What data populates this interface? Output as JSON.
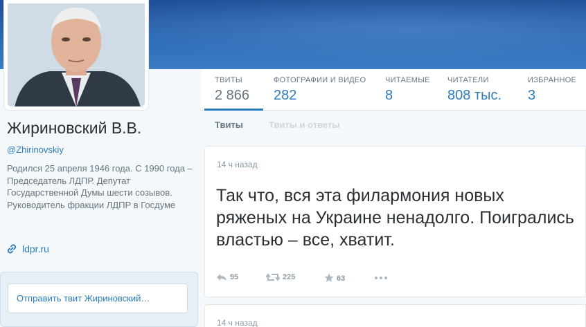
{
  "profile": {
    "name": "Жириновский В.В.",
    "handle": "@Zhirinovskiy",
    "bio": "Родился 25 апреля 1946 года. С 1990 года – Председатель ЛДПР. Депутат Государственной Думы шести созывов. Руководитель фракции ЛДПР в Госдуме",
    "link": "ldpr.ru",
    "link_icon": "link-icon",
    "send_placeholder": "Отправить твит Жириновский…"
  },
  "stats": [
    {
      "label": "ТВИТЫ",
      "value": "2 866"
    },
    {
      "label": "ФОТОГРАФИИ И ВИДЕО",
      "value": "282"
    },
    {
      "label": "ЧИТАЕМЫЕ",
      "value": "8"
    },
    {
      "label": "ЧИТАТЕЛИ",
      "value": "808 тыс."
    },
    {
      "label": "ИЗБРАННОЕ",
      "value": "3"
    }
  ],
  "tabs": {
    "tweets": "Твиты",
    "replies": "Твиты и ответы"
  },
  "tweets": [
    {
      "time": "14 ч назад",
      "text": "Так что, вся эта филармония новых ряженых на Украине ненадолго. Поигрались властью – все, хватит.",
      "replies": "95",
      "retweets": "225",
      "favorites": "63"
    },
    {
      "time": "14 ч назад"
    }
  ],
  "colors": {
    "accent": "#2b7bb9",
    "banner": "#2c69b4",
    "muted": "#66757f"
  }
}
